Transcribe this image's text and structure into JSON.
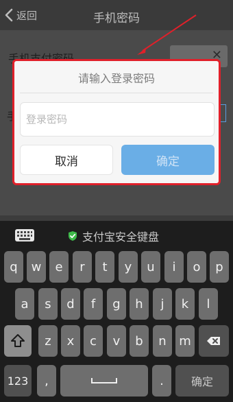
{
  "navbar": {
    "back_label": "返回",
    "title": "手机密码"
  },
  "page": {
    "row1_label": "手机支付密码"
  },
  "modal": {
    "title": "请输入登录密码",
    "input_placeholder": "登录密码",
    "cancel_label": "取消",
    "confirm_label": "确定"
  },
  "keyboard": {
    "title": "支付宝安全键盘",
    "row1": [
      "q",
      "w",
      "e",
      "r",
      "t",
      "y",
      "u",
      "i",
      "o",
      "p"
    ],
    "row2": [
      "a",
      "s",
      "d",
      "f",
      "g",
      "h",
      "j",
      "k",
      "l"
    ],
    "row3": [
      "z",
      "x",
      "c",
      "v",
      "b",
      "n",
      "m"
    ],
    "numbers_label": "123",
    "comma_label": ",",
    "period_label": ".",
    "confirm_label": "确定"
  },
  "colors": {
    "highlight": "#e0202a",
    "confirm_button": "#6aaee6"
  }
}
